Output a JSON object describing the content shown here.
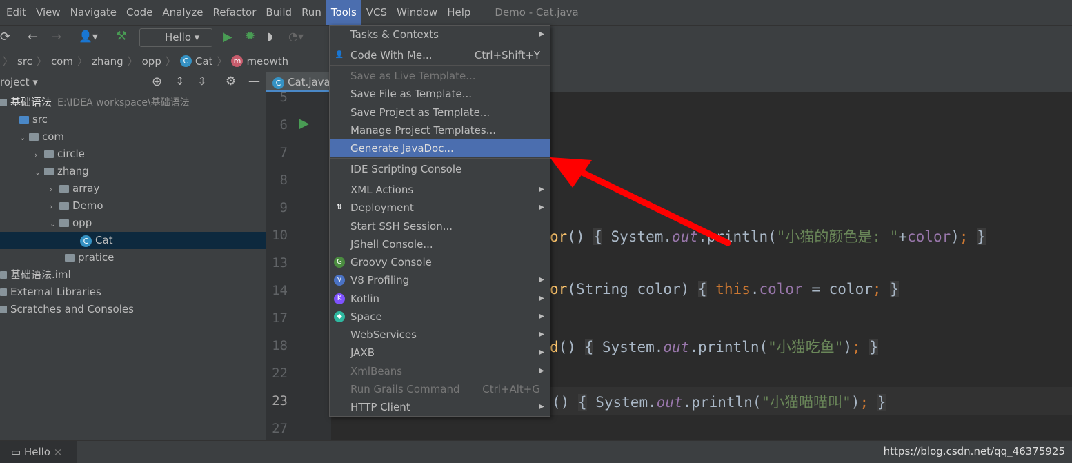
{
  "menubar": {
    "items": [
      "Edit",
      "View",
      "Navigate",
      "Code",
      "Analyze",
      "Refactor",
      "Build",
      "Run",
      "Tools",
      "VCS",
      "Window",
      "Help"
    ],
    "active": "Tools",
    "window_title": "Demo - Cat.java"
  },
  "toolbar": {
    "run_config": "Hello"
  },
  "breadcrumb": [
    "src",
    "com",
    "zhang",
    "opp",
    "Cat",
    "meowth"
  ],
  "project": {
    "header": "roject",
    "tree": [
      {
        "label": "基础语法",
        "extra": "E:\\IDEA workspace\\基础语法",
        "indent": 0,
        "type": "module",
        "bold": true
      },
      {
        "label": "src",
        "indent": 1,
        "type": "folder-src"
      },
      {
        "label": "com",
        "indent": 1,
        "type": "package",
        "arrow": "v"
      },
      {
        "label": "circle",
        "indent": 2,
        "type": "package",
        "arrow": ">"
      },
      {
        "label": "zhang",
        "indent": 2,
        "type": "package",
        "arrow": "v"
      },
      {
        "label": "array",
        "indent": 3,
        "type": "package",
        "arrow": ">"
      },
      {
        "label": "Demo",
        "indent": 3,
        "type": "package",
        "arrow": ">"
      },
      {
        "label": "opp",
        "indent": 3,
        "type": "package",
        "arrow": "v"
      },
      {
        "label": "Cat",
        "indent": 5,
        "type": "class",
        "selected": true
      },
      {
        "label": "pratice",
        "indent": 4,
        "type": "package"
      },
      {
        "label": "基础语法.iml",
        "indent": 0,
        "type": "file"
      },
      {
        "label": "External Libraries",
        "indent": 0,
        "type": "lib"
      },
      {
        "label": "Scratches and Consoles",
        "indent": 0,
        "type": "scratch"
      }
    ]
  },
  "editor": {
    "tab": "Cat.java",
    "line_numbers": [
      "5",
      "6",
      "7",
      "8",
      "9",
      "10",
      "13",
      "14",
      "17",
      "18",
      "22",
      "23",
      "27"
    ],
    "current_line": "23"
  },
  "tools_menu": {
    "items": [
      {
        "label": "Tasks & Contexts",
        "submenu": true
      },
      {
        "label": "Code With Me...",
        "shortcut": "Ctrl+Shift+Y",
        "icon": "people-icon"
      },
      {
        "label": "Save as Live Template...",
        "disabled": true
      },
      {
        "label": "Save File as Template..."
      },
      {
        "label": "Save Project as Template..."
      },
      {
        "label": "Manage Project Templates..."
      },
      {
        "label": "Generate JavaDoc...",
        "highlighted": true
      },
      {
        "label": "IDE Scripting Console"
      },
      {
        "label": "XML Actions",
        "submenu": true
      },
      {
        "label": "Deployment",
        "submenu": true,
        "icon": "deployment-icon"
      },
      {
        "label": "Start SSH Session..."
      },
      {
        "label": "JShell Console..."
      },
      {
        "label": "Groovy Console",
        "icon": "groovy-icon"
      },
      {
        "label": "V8 Profiling",
        "submenu": true,
        "icon": "v8-icon"
      },
      {
        "label": "Kotlin",
        "submenu": true,
        "icon": "kotlin-icon"
      },
      {
        "label": "Space",
        "submenu": true,
        "icon": "space-icon"
      },
      {
        "label": "WebServices",
        "submenu": true
      },
      {
        "label": "JAXB",
        "submenu": true
      },
      {
        "label": "XmlBeans",
        "submenu": true,
        "disabled": true
      },
      {
        "label": "Run Grails Command",
        "shortcut": "Ctrl+Alt+G",
        "disabled": true
      },
      {
        "label": "HTTP Client",
        "submenu": true
      }
    ]
  },
  "bottom": {
    "tab": "Hello",
    "watermark": "https://blog.csdn.net/qq_46375925"
  },
  "colors": {
    "menu_highlight": "#4b6eaf",
    "annotation_arrow": "#ff0000"
  }
}
